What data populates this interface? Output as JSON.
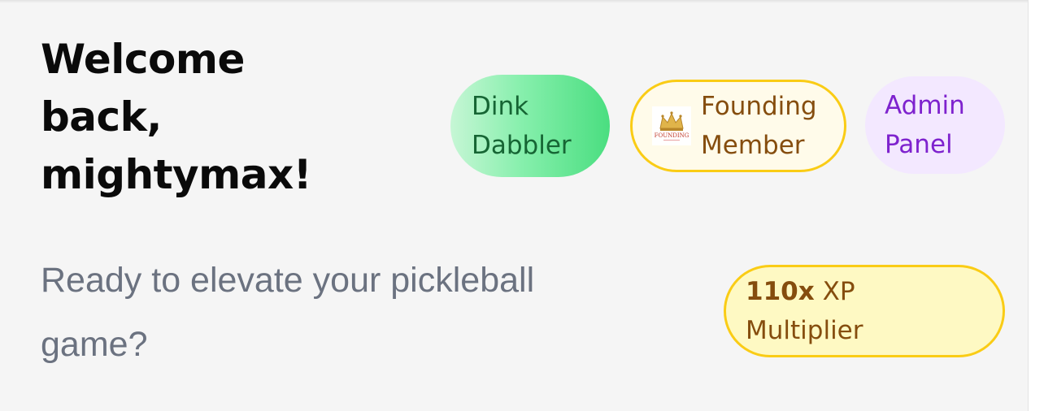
{
  "welcome": {
    "line1": "Welcome",
    "line2": "back,",
    "line3": "mightymax!"
  },
  "subtitle": {
    "line1": "Ready to elevate your pickleball",
    "line2": "game?"
  },
  "badges": {
    "dink": {
      "line1": "Dink",
      "line2": "Dabbler"
    },
    "founding": {
      "line1": "Founding",
      "line2": "Member",
      "logo_icon": "crown-icon",
      "logo_text": "FOUNDING"
    },
    "admin": {
      "line1": "Admin",
      "line2": "Panel"
    },
    "xp": {
      "multiplier": "110x",
      "label": "XP",
      "line2": "Multiplier"
    }
  },
  "colors": {
    "background": "#f5f5f5",
    "heading": "#0a0a0a",
    "subtitle": "#6b7280",
    "dink_text": "#166534",
    "founding_text": "#854d0e",
    "founding_border": "#facc15",
    "admin_bg": "#f3e8ff",
    "admin_text": "#7e22ce",
    "xp_bg": "#fef9c3"
  }
}
